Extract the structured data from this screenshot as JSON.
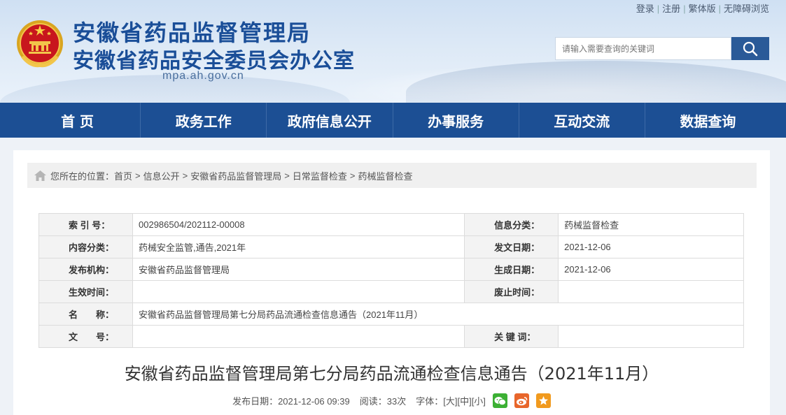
{
  "header": {
    "title_main": "安徽省药品监督管理局",
    "title_sub": "安徽省药品安全委员会办公室",
    "domain": "mpa.ah.gov.cn",
    "toplinks": [
      "登录",
      "注册",
      "繁体版",
      "无障碍浏览"
    ],
    "search": {
      "placeholder": "请输入需要查询的关键词"
    }
  },
  "nav": [
    "首 页",
    "政务工作",
    "政府信息公开",
    "办事服务",
    "互动交流",
    "数据查询"
  ],
  "breadcrumb": {
    "prefix": "您所在的位置：",
    "items": [
      "首页",
      "信息公开",
      "安徽省药品监督管理局",
      "日常监督检查",
      "药械监督检查"
    ]
  },
  "meta": {
    "index_label": "索 引 号：",
    "index_value": "002986504/202112-00008",
    "info_cat_label": "信息分类：",
    "info_cat_value": "药械监督检查",
    "content_cat_label": "内容分类：",
    "content_cat_value": "药械安全监管,通告,2021年",
    "issue_date_label": "发文日期：",
    "issue_date_value": "2021-12-06",
    "org_label": "发布机构：",
    "org_value": "安徽省药品监督管理局",
    "gen_date_label": "生成日期：",
    "gen_date_value": "2021-12-06",
    "effective_label": "生效时间：",
    "effective_value": "",
    "abolish_label": "废止时间：",
    "abolish_value": "",
    "name_label": "名　　称：",
    "name_value": "安徽省药品监督管理局第七分局药品流通检查信息通告（2021年11月）",
    "docno_label": "文　　号：",
    "docno_value": "",
    "keywords_label": "关 键 词：",
    "keywords_value": ""
  },
  "article": {
    "title": "安徽省药品监督管理局第七分局药品流通检查信息通告（2021年11月）",
    "publish": "发布日期：2021-12-06 09:39",
    "reads": "阅读：33次",
    "font_label": "字体：",
    "font_large": "[大]",
    "font_medium": "[中]",
    "font_small": "[小]"
  },
  "colors": {
    "nav_bg": "#1c4f94",
    "title_blue": "#1a4e98",
    "wechat": "#3cb034",
    "weibo": "#e8662b",
    "favorite": "#f19a1e"
  }
}
